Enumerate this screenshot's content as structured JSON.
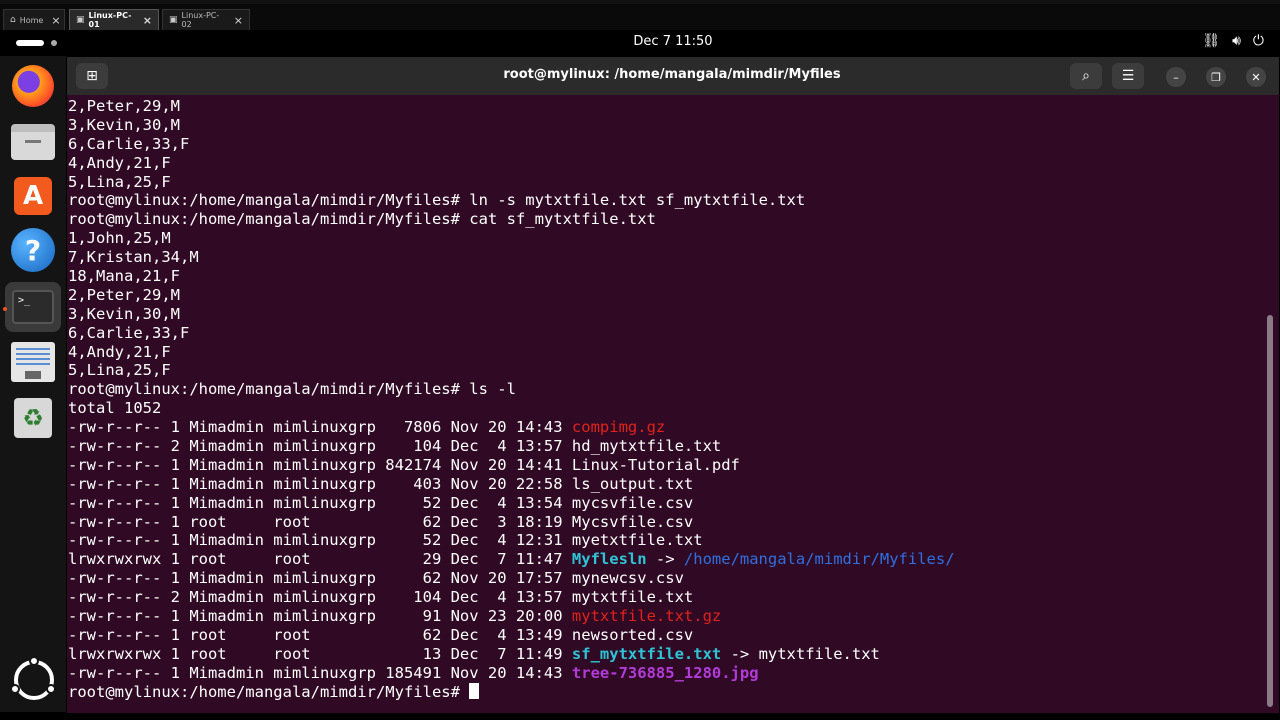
{
  "outer_tabs": [
    {
      "label": "Home",
      "active": false
    },
    {
      "label": "Linux-PC-01",
      "active": true
    },
    {
      "label": "Linux-PC-02",
      "active": false
    }
  ],
  "topbar": {
    "clock": "Dec 7  11:50",
    "tray_icons": [
      "network-icon",
      "volume-icon",
      "power-icon"
    ]
  },
  "dock": {
    "items": [
      "firefox-icon",
      "files-icon",
      "app-center-icon",
      "help-icon",
      "terminal-icon",
      "text-editor-icon",
      "trash-icon",
      "show-apps-icon"
    ],
    "active": "terminal-icon"
  },
  "window": {
    "title": "root@mylinux: /home/mangala/mimdir/Myfiles"
  },
  "colors": {
    "terminal_bg": "#300a24",
    "archive": "#e0221c",
    "symlink": "#2ec4d6",
    "dir": "#2f6fe0",
    "image": "#b23bd9"
  },
  "terminal": {
    "prompt": "root@mylinux:/home/mangala/mimdir/Myfiles# ",
    "pre_lines": [
      "2,Peter,29,M",
      "3,Kevin,30,M",
      "6,Carlie,33,F",
      "4,Andy,21,F",
      "5,Lina,25,F"
    ],
    "cmd1": "ln -s mytxtfile.txt sf_mytxtfile.txt",
    "cmd2": "cat sf_mytxtfile.txt",
    "cat_lines": [
      "1,John,25,M",
      "7,Kristan,34,M",
      "18,Mana,21,F",
      "2,Peter,29,M",
      "3,Kevin,30,M",
      "6,Carlie,33,F",
      "4,Andy,21,F",
      "5,Lina,25,F"
    ],
    "cmd3": "ls -l",
    "total": "total 1052",
    "listing": [
      {
        "meta": "-rw-r--r-- 1 Mimadmin mimlinuxgrp   7806 Nov 20 14:43 ",
        "name": "compimg.gz",
        "type": "archive"
      },
      {
        "meta": "-rw-r--r-- 2 Mimadmin mimlinuxgrp    104 Dec  4 13:57 ",
        "name": "hd_mytxtfile.txt",
        "type": "file"
      },
      {
        "meta": "-rw-r--r-- 1 Mimadmin mimlinuxgrp 842174 Nov 20 14:41 ",
        "name": "Linux-Tutorial.pdf",
        "type": "file"
      },
      {
        "meta": "-rw-r--r-- 1 Mimadmin mimlinuxgrp    403 Nov 20 22:58 ",
        "name": "ls_output.txt",
        "type": "file"
      },
      {
        "meta": "-rw-r--r-- 1 Mimadmin mimlinuxgrp     52 Dec  4 13:54 ",
        "name": "mycsvfile.csv",
        "type": "file"
      },
      {
        "meta": "-rw-r--r-- 1 root     root            62 Dec  3 18:19 ",
        "name": "Mycsvfile.csv",
        "type": "file"
      },
      {
        "meta": "-rw-r--r-- 1 Mimadmin mimlinuxgrp     52 Dec  4 12:31 ",
        "name": "myetxtfile.txt",
        "type": "file"
      },
      {
        "meta": "lrwxrwxrwx 1 root     root            29 Dec  7 11:47 ",
        "name": "Myflesln",
        "type": "symlink",
        "arrow": " -> ",
        "target": "/home/mangala/mimdir/Myfiles/",
        "target_type": "dir"
      },
      {
        "meta": "-rw-r--r-- 1 Mimadmin mimlinuxgrp     62 Nov 20 17:57 ",
        "name": "mynewcsv.csv",
        "type": "file"
      },
      {
        "meta": "-rw-r--r-- 2 Mimadmin mimlinuxgrp    104 Dec  4 13:57 ",
        "name": "mytxtfile.txt",
        "type": "file"
      },
      {
        "meta": "-rw-r--r-- 1 Mimadmin mimlinuxgrp     91 Nov 23 20:00 ",
        "name": "mytxtfile.txt.gz",
        "type": "archive"
      },
      {
        "meta": "-rw-r--r-- 1 root     root            62 Dec  4 13:49 ",
        "name": "newsorted.csv",
        "type": "file"
      },
      {
        "meta": "lrwxrwxrwx 1 root     root            13 Dec  7 11:49 ",
        "name": "sf_mytxtfile.txt",
        "type": "symlink",
        "arrow": " -> ",
        "target": "mytxtfile.txt",
        "target_type": "file"
      },
      {
        "meta": "-rw-r--r-- 1 Mimadmin mimlinuxgrp 185491 Nov 20 14:43 ",
        "name": "tree-736885_1280.jpg",
        "type": "image"
      }
    ]
  }
}
